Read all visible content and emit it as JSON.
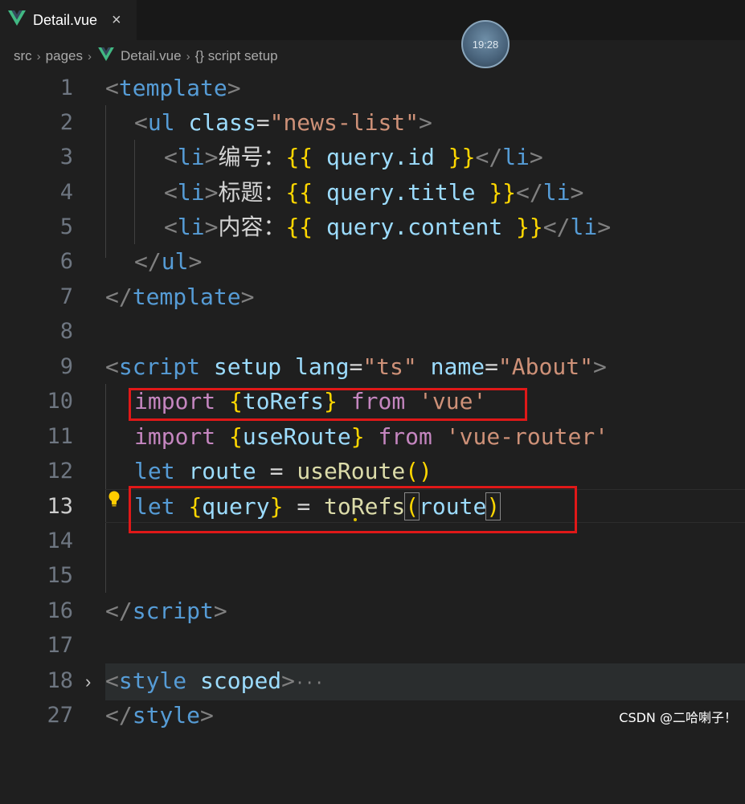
{
  "tab": {
    "label": "Detail.vue",
    "close": "×"
  },
  "clock": {
    "time": "19:28"
  },
  "breadcrumb": {
    "src": "src",
    "pages": "pages",
    "file": "Detail.vue",
    "symbol": "{} script setup"
  },
  "line_numbers": [
    "1",
    "2",
    "3",
    "4",
    "5",
    "6",
    "7",
    "8",
    "9",
    "10",
    "11",
    "12",
    "13",
    "14",
    "15",
    "16",
    "17",
    "18",
    "27"
  ],
  "code": {
    "l1": {
      "open": "<",
      "tag": "template",
      "close": ">"
    },
    "l2": {
      "open": "<",
      "tag": "ul",
      "attr": "class",
      "eq": "=",
      "value": "\"news-list\"",
      "close": ">"
    },
    "l3": {
      "open": "<",
      "tag": "li",
      "close": ">",
      "text": "编号：",
      "mustache_open": "{{",
      "expr": "query.id",
      "mustache_close": "}}",
      "end_open": "</",
      "end_close": ">"
    },
    "l4": {
      "open": "<",
      "tag": "li",
      "close": ">",
      "text": "标题：",
      "mustache_open": "{{",
      "expr": "query.title",
      "mustache_close": "}}",
      "end_open": "</",
      "end_close": ">"
    },
    "l5": {
      "open": "<",
      "tag": "li",
      "close": ">",
      "text": "内容：",
      "mustache_open": "{{",
      "expr": "query.content",
      "mustache_close": "}}",
      "end_open": "</",
      "end_close": ">"
    },
    "l6": {
      "open": "</",
      "tag": "ul",
      "close": ">"
    },
    "l7": {
      "open": "</",
      "tag": "template",
      "close": ">"
    },
    "l9": {
      "open": "<",
      "tag": "script",
      "attr1": "setup",
      "attr2": "lang",
      "eq": "=",
      "val2": "\"ts\"",
      "attr3": "name",
      "val3": "\"About\"",
      "close": ">"
    },
    "l10": {
      "kw": "import",
      "brace_open": "{",
      "name": "toRefs",
      "brace_close": "}",
      "from": "from",
      "module": "'vue'"
    },
    "l11": {
      "kw": "import",
      "brace_open": "{",
      "name": "useRoute",
      "brace_close": "}",
      "from": "from",
      "module": "'vue-router'"
    },
    "l12": {
      "let": "let",
      "var": "route",
      "eq": "=",
      "fn": "useRoute",
      "paren_open": "(",
      "paren_close": ")"
    },
    "l13": {
      "let": "let",
      "brace_open": "{",
      "var": "query",
      "brace_close": "}",
      "eq": "=",
      "fn": "toRefs",
      "paren_open": "(",
      "arg": "route",
      "paren_close": ")"
    },
    "l16": {
      "open": "</",
      "tag": "script",
      "close": ">"
    },
    "l18": {
      "open": "<",
      "tag": "style",
      "attr": "scoped",
      "close": ">",
      "ellipsis": "···"
    },
    "l27": {
      "open": "</",
      "tag": "style",
      "close": ">"
    }
  },
  "watermark": "CSDN @二哈喇子！",
  "colors": {
    "highlight": "#e01818",
    "background": "#1f1f1f"
  },
  "icons": {
    "vue": "vue-logo-icon",
    "bulb": "lightbulb-icon",
    "fold": "chevron-right-icon"
  }
}
